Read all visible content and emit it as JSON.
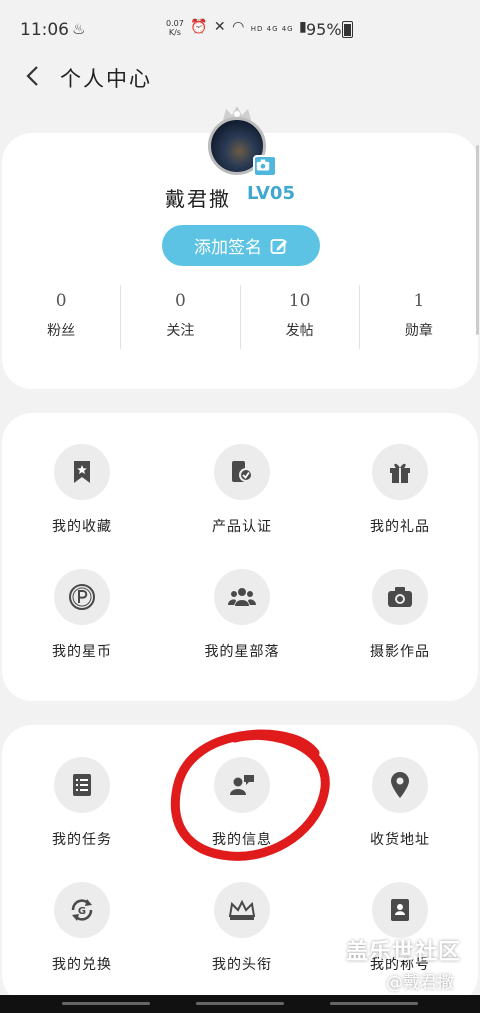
{
  "status_bar": {
    "time": "11:06",
    "speed_top": "0.07",
    "speed_bottom": "K/s",
    "signal_text": "HD 4G 4G",
    "battery": "95%"
  },
  "header": {
    "title": "个人中心"
  },
  "profile": {
    "username": "戴君撒",
    "level": "LV05",
    "signature_button": "添加签名",
    "stats": [
      {
        "value": "0",
        "label": "粉丝"
      },
      {
        "value": "0",
        "label": "关注"
      },
      {
        "value": "10",
        "label": "发帖"
      },
      {
        "value": "1",
        "label": "勋章"
      }
    ]
  },
  "menu1": {
    "items": [
      {
        "label": "我的收藏",
        "icon": "bookmark-star-icon"
      },
      {
        "label": "产品认证",
        "icon": "device-check-icon"
      },
      {
        "label": "我的礼品",
        "icon": "gift-icon"
      },
      {
        "label": "我的星币",
        "icon": "coin-p-icon"
      },
      {
        "label": "我的星部落",
        "icon": "group-icon"
      },
      {
        "label": "摄影作品",
        "icon": "camera-icon"
      }
    ]
  },
  "menu2": {
    "items": [
      {
        "label": "我的任务",
        "icon": "task-list-icon"
      },
      {
        "label": "我的信息",
        "icon": "message-user-icon"
      },
      {
        "label": "收货地址",
        "icon": "location-pin-icon"
      },
      {
        "label": "我的兑换",
        "icon": "exchange-icon"
      },
      {
        "label": "我的头衔",
        "icon": "crown-icon"
      },
      {
        "label": "我的称号",
        "icon": "badge-card-icon"
      }
    ]
  },
  "watermark": {
    "line1": "盖乐世社区",
    "line2": "@戴君撒"
  },
  "colors": {
    "accent": "#5cc3e4",
    "level": "#3fa8d0",
    "annotation": "#e01b1b"
  }
}
